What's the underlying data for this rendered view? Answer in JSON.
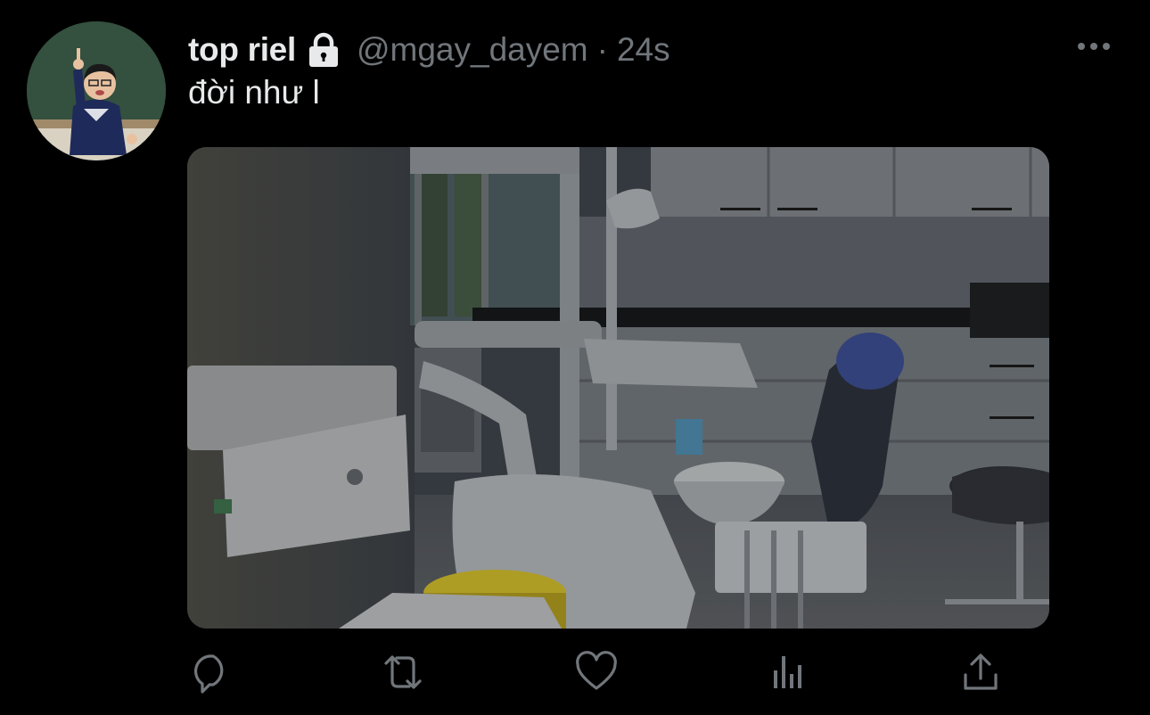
{
  "tweet": {
    "display_name": "top riel",
    "handle": "@mgay_dayem",
    "separator": "·",
    "time": "24s",
    "text": "đời như l",
    "protected": true
  },
  "icons": {
    "lock": "lock-icon",
    "more": "more-horizontal-icon",
    "reply": "reply-icon",
    "retweet": "retweet-icon",
    "like": "heart-icon",
    "views": "analytics-icon",
    "share": "share-icon"
  },
  "colors": {
    "background": "#000000",
    "text_primary": "#e7e9ea",
    "text_secondary": "#71767b"
  }
}
